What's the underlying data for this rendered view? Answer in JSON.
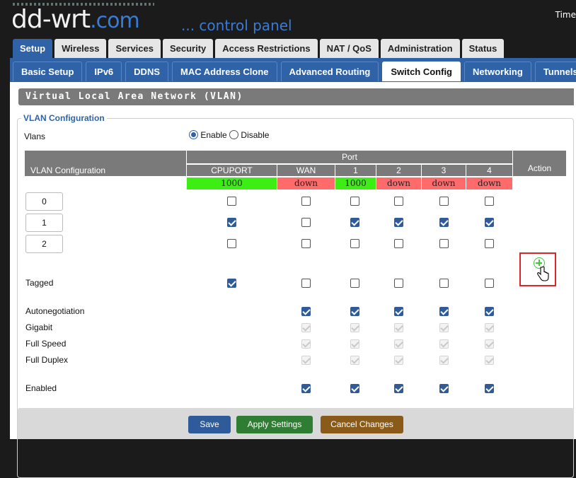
{
  "header": {
    "logo_main": "dd-wrt",
    "logo_suffix": ".com",
    "tagline": "... control panel",
    "time_label": "Time"
  },
  "main_tabs": [
    {
      "label": "Setup",
      "active": true
    },
    {
      "label": "Wireless"
    },
    {
      "label": "Services"
    },
    {
      "label": "Security"
    },
    {
      "label": "Access Restrictions"
    },
    {
      "label": "NAT / QoS"
    },
    {
      "label": "Administration"
    },
    {
      "label": "Status"
    }
  ],
  "sub_tabs": [
    {
      "label": "Basic Setup"
    },
    {
      "label": "IPv6"
    },
    {
      "label": "DDNS"
    },
    {
      "label": "MAC Address Clone"
    },
    {
      "label": "Advanced Routing"
    },
    {
      "label": "Switch Config",
      "active": true
    },
    {
      "label": "Networking"
    },
    {
      "label": "Tunnels"
    }
  ],
  "section_title": "Virtual Local Area Network (VLAN)",
  "fieldset_legend": "VLAN Configuration",
  "vlans": {
    "label": "Vlans",
    "enable_label": "Enable",
    "disable_label": "Disable",
    "selected": "Enable"
  },
  "table": {
    "row_header": "VLAN Configuration",
    "port_group_header": "Port",
    "action_header": "Action",
    "ports": [
      {
        "name": "CPUPORT",
        "speed": "1000",
        "state": "up"
      },
      {
        "name": "WAN",
        "speed": "down",
        "state": "down"
      },
      {
        "name": "1",
        "speed": "1000",
        "state": "up"
      },
      {
        "name": "2",
        "speed": "down",
        "state": "down"
      },
      {
        "name": "3",
        "speed": "down",
        "state": "down"
      },
      {
        "name": "4",
        "speed": "down",
        "state": "down"
      }
    ],
    "vlan_rows": [
      {
        "id": "0",
        "checked": [
          false,
          false,
          false,
          false,
          false,
          false
        ]
      },
      {
        "id": "1",
        "checked": [
          true,
          false,
          true,
          true,
          true,
          true
        ]
      },
      {
        "id": "2",
        "checked": [
          false,
          false,
          false,
          false,
          false,
          false
        ]
      }
    ],
    "option_rows": [
      {
        "label": "Tagged",
        "checked": [
          true,
          false,
          false,
          false,
          false,
          false
        ],
        "disabled": false
      },
      {
        "label": "Autonegotiation",
        "checked": [
          null,
          true,
          true,
          true,
          true,
          true
        ],
        "disabled": false
      },
      {
        "label": "Gigabit",
        "checked": [
          null,
          true,
          true,
          true,
          true,
          true
        ],
        "disabled": true
      },
      {
        "label": "Full Speed",
        "checked": [
          null,
          true,
          true,
          true,
          true,
          true
        ],
        "disabled": true
      },
      {
        "label": "Full Duplex",
        "checked": [
          null,
          true,
          true,
          true,
          true,
          true
        ],
        "disabled": true
      },
      {
        "label": "Enabled",
        "checked": [
          null,
          true,
          true,
          true,
          true,
          true
        ],
        "disabled": false
      }
    ],
    "add_action_icon": "plus-circle-icon"
  },
  "buttons": {
    "save": "Save",
    "apply": "Apply Settings",
    "cancel": "Cancel Changes"
  },
  "colors": {
    "tab_active": "#2f62a6",
    "speed_up": "#3dee14",
    "speed_down": "#ff6b6b",
    "save_btn": "#2f5b9a",
    "apply_btn": "#2e7d32",
    "cancel_btn": "#8a5a19"
  }
}
